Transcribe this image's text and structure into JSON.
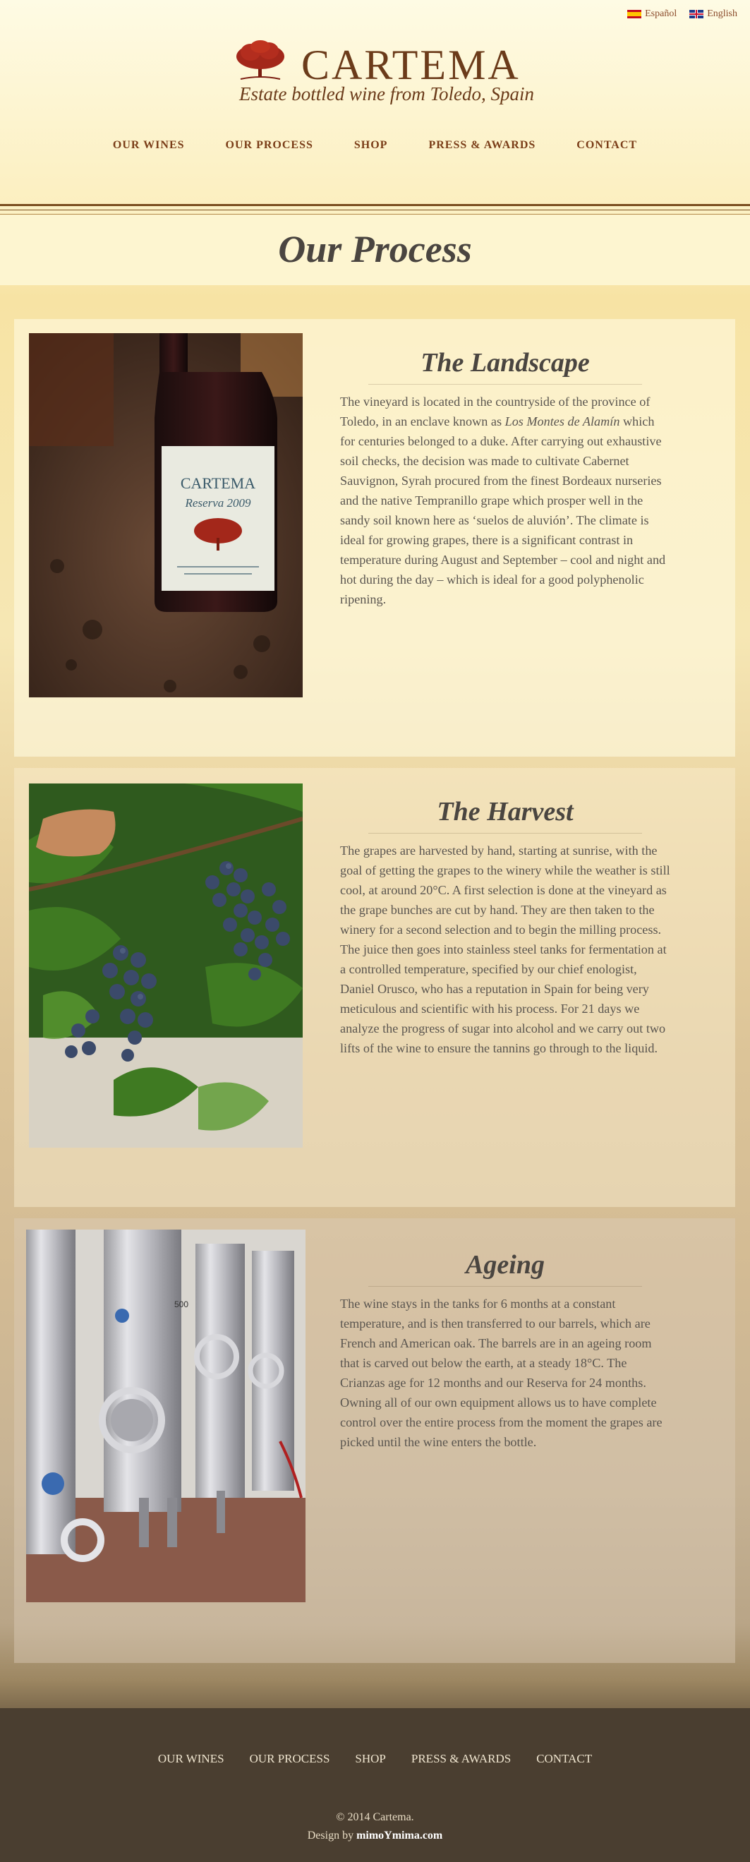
{
  "lang": {
    "es": "Español",
    "en": "English"
  },
  "brand": {
    "name": "CARTEMA",
    "tagline": "Estate bottled wine from Toledo, Spain"
  },
  "nav": [
    "OUR WINES",
    "OUR PROCESS",
    "SHOP",
    "PRESS & AWARDS",
    "CONTACT"
  ],
  "page_title": "Our Process",
  "sections": [
    {
      "title": "The Landscape",
      "body_a": "The vineyard is located in the countryside of the province of Toledo, in an enclave known as ",
      "body_em": "Los Montes de Alamín",
      "body_b": " which for centuries belonged to a duke. After carrying out exhaustive soil checks, the decision was made to cultivate Cabernet Sauvignon, Syrah procured from the finest Bordeaux nurseries and the native Tempranillo grape which prosper well in the sandy soil known here as ‘suelos de aluvión’. The climate is ideal for growing grapes, there is a significant contrast in temperature during August and September – cool and night and hot during the day – which is ideal for a good polyphenolic ripening.",
      "bottle_label": "CARTEMA",
      "bottle_sub": "Reserva 2009"
    },
    {
      "title": "The Harvest",
      "body": "The grapes are harvested by hand, starting at sunrise, with the goal of getting the grapes to the winery while the weather is still cool, at around 20°C. A first selection is done at the vineyard as the grape bunches are cut by hand. They are then taken to the winery for a second selection and to begin the milling process. The juice then goes into stainless steel tanks for fermentation at a controlled temperature, specified by our chief enologist, Daniel Orusco, who has a reputation in Spain for being very meticulous and scientific with his process. For 21 days we analyze the progress of sugar into alcohol and we carry out two lifts of the wine to ensure the tannins go through to the liquid."
    },
    {
      "title": "Ageing",
      "body": "The wine stays in the tanks for 6 months at a constant temperature, and is then transferred to our barrels, which are French and American oak. The barrels are in an ageing room that is carved out below the earth, at a steady 18°C. The Crianzas age for 12 months and our Reserva for 24 months. Owning all of our own equipment allows us to have complete control over the entire process from the moment the grapes are picked until the wine enters the bottle.",
      "tank_mark": "500"
    }
  ],
  "footer": {
    "copyright": "© 2014 Cartema.",
    "design_prefix": "Design by ",
    "design_by": "mimoYmima.com"
  },
  "colors": {
    "brand": "#6b3b1a",
    "nav": "#7a3d18",
    "footer_bg": "#4a3e30"
  }
}
